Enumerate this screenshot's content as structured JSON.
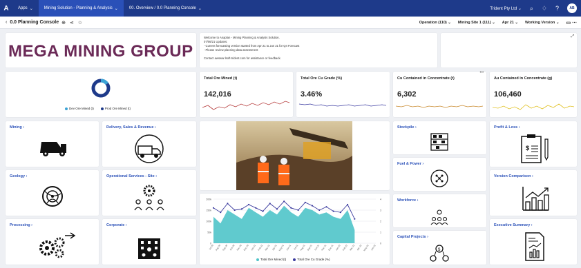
{
  "topbar": {
    "logo": "A",
    "breadcrumbs": [
      "Apps",
      "Mining Solution - Planning & Analysis",
      "00. Overview / 0.0 Planning Console"
    ],
    "tenant": "Trident Pty Ltd",
    "avatar": "AB"
  },
  "subbar": {
    "page_title": "0.0 Planning Console",
    "filters": [
      "Operation (110)",
      "Mining Site 1 (111)",
      "Apr 21",
      "Working Version"
    ]
  },
  "brand": {
    "logo_text": "MEGA MINING GROUP",
    "color": "#6b2a57"
  },
  "notes": {
    "lines": [
      "Welcome to Anaplan - Mining Planning & Analysis Solution.",
      "07/06/21 Updates:",
      "- Current forecasting version started from Apr 21 to Jun 21 for Q4 Forecast",
      "- Please review planning data assessment",
      "",
      "Contact awswar.lsoft-trident.com for assistance or feedback."
    ]
  },
  "donut": {
    "legend": [
      {
        "label": "Dev Ore Mined (t)",
        "color": "#3ba3d6"
      },
      {
        "label": "Prod Ore Mined (t)",
        "color": "#1e3a8a"
      }
    ],
    "dev_fraction": 0.15
  },
  "kpis": [
    {
      "title": "Total Ore Mined (t)",
      "value": "142,016",
      "color": "#b53a3a"
    },
    {
      "title": "Total Ore Cu Grade (%)",
      "value": "3.46%",
      "color": "#3a3aa0"
    },
    {
      "title": "Cu Contained in Concentrate (t)",
      "value": "6,302",
      "color": "#c98a2e"
    },
    {
      "title": "Au Contained in Concentrate (g)",
      "value": "106,460",
      "color": "#e0c020"
    }
  ],
  "tiles_left": [
    {
      "label": "Mining",
      "icon": "dump-truck-icon"
    },
    {
      "label": "Geology",
      "icon": "geology-icon"
    },
    {
      "label": "Processing",
      "icon": "gears-icon"
    }
  ],
  "tiles_mid": [
    {
      "label": "Delivery, Sales & Revenue",
      "icon": "delivery-truck-icon"
    },
    {
      "label": "Operational Services - Site",
      "icon": "team-gear-icon"
    },
    {
      "label": "Corporate",
      "icon": "corporate-icon"
    }
  ],
  "tiles_right1": [
    {
      "label": "Stockpile",
      "icon": "stockpile-icon"
    },
    {
      "label": "Fuel & Power",
      "icon": "power-icon"
    },
    {
      "label": "Workforce",
      "icon": "workforce-icon"
    },
    {
      "label": "Capital Projects",
      "icon": "capital-icon"
    }
  ],
  "tiles_right2": [
    {
      "label": "Profit & Loss",
      "icon": "clipboard-icon"
    },
    {
      "label": "Version Comparison",
      "icon": "bar-chart-icon"
    },
    {
      "label": "Executive Summary",
      "icon": "report-icon"
    }
  ],
  "chart_data": {
    "type": "area",
    "x": [
      "Jul 20",
      "Aug 20",
      "Sep 20",
      "Oct 20",
      "Nov 20",
      "Dec 20",
      "Jan 21",
      "Feb 21",
      "Mar 21",
      "Apr 21",
      "May 21",
      "Jun 21",
      "Jul 21",
      "Aug 21",
      "Sep 21",
      "Oct 21",
      "Nov 21",
      "Dec 21",
      "Jan 22",
      "Feb 22",
      "Mar 22",
      "Apr 22",
      "May 22",
      "Jun 22"
    ],
    "series": [
      {
        "name": "Total Ore Mined (t)",
        "type": "area",
        "color": "#4fc4c9",
        "values": [
          120,
          90,
          150,
          130,
          110,
          160,
          140,
          120,
          150,
          130,
          170,
          140,
          120,
          160,
          150,
          130,
          140,
          120,
          110,
          150,
          60,
          null,
          null,
          null
        ]
      },
      {
        "name": "Total Ore Cu Grade (%)",
        "type": "line",
        "color": "#3a3a9e",
        "values": [
          3.2,
          2.8,
          3.6,
          3.0,
          3.1,
          3.5,
          3.2,
          2.9,
          3.6,
          3.1,
          3.8,
          3.2,
          3.0,
          3.7,
          3.4,
          3.0,
          3.3,
          2.9,
          2.8,
          3.5,
          2.2,
          null,
          null,
          null
        ]
      }
    ],
    "y_left_ticks": [
      "200k",
      "150k",
      "100k",
      "50k",
      "0"
    ],
    "y_right_ticks": [
      "4",
      "3",
      "2",
      "1",
      "0"
    ],
    "ylim_left": [
      0,
      200
    ],
    "ylim_right": [
      0,
      4
    ]
  }
}
